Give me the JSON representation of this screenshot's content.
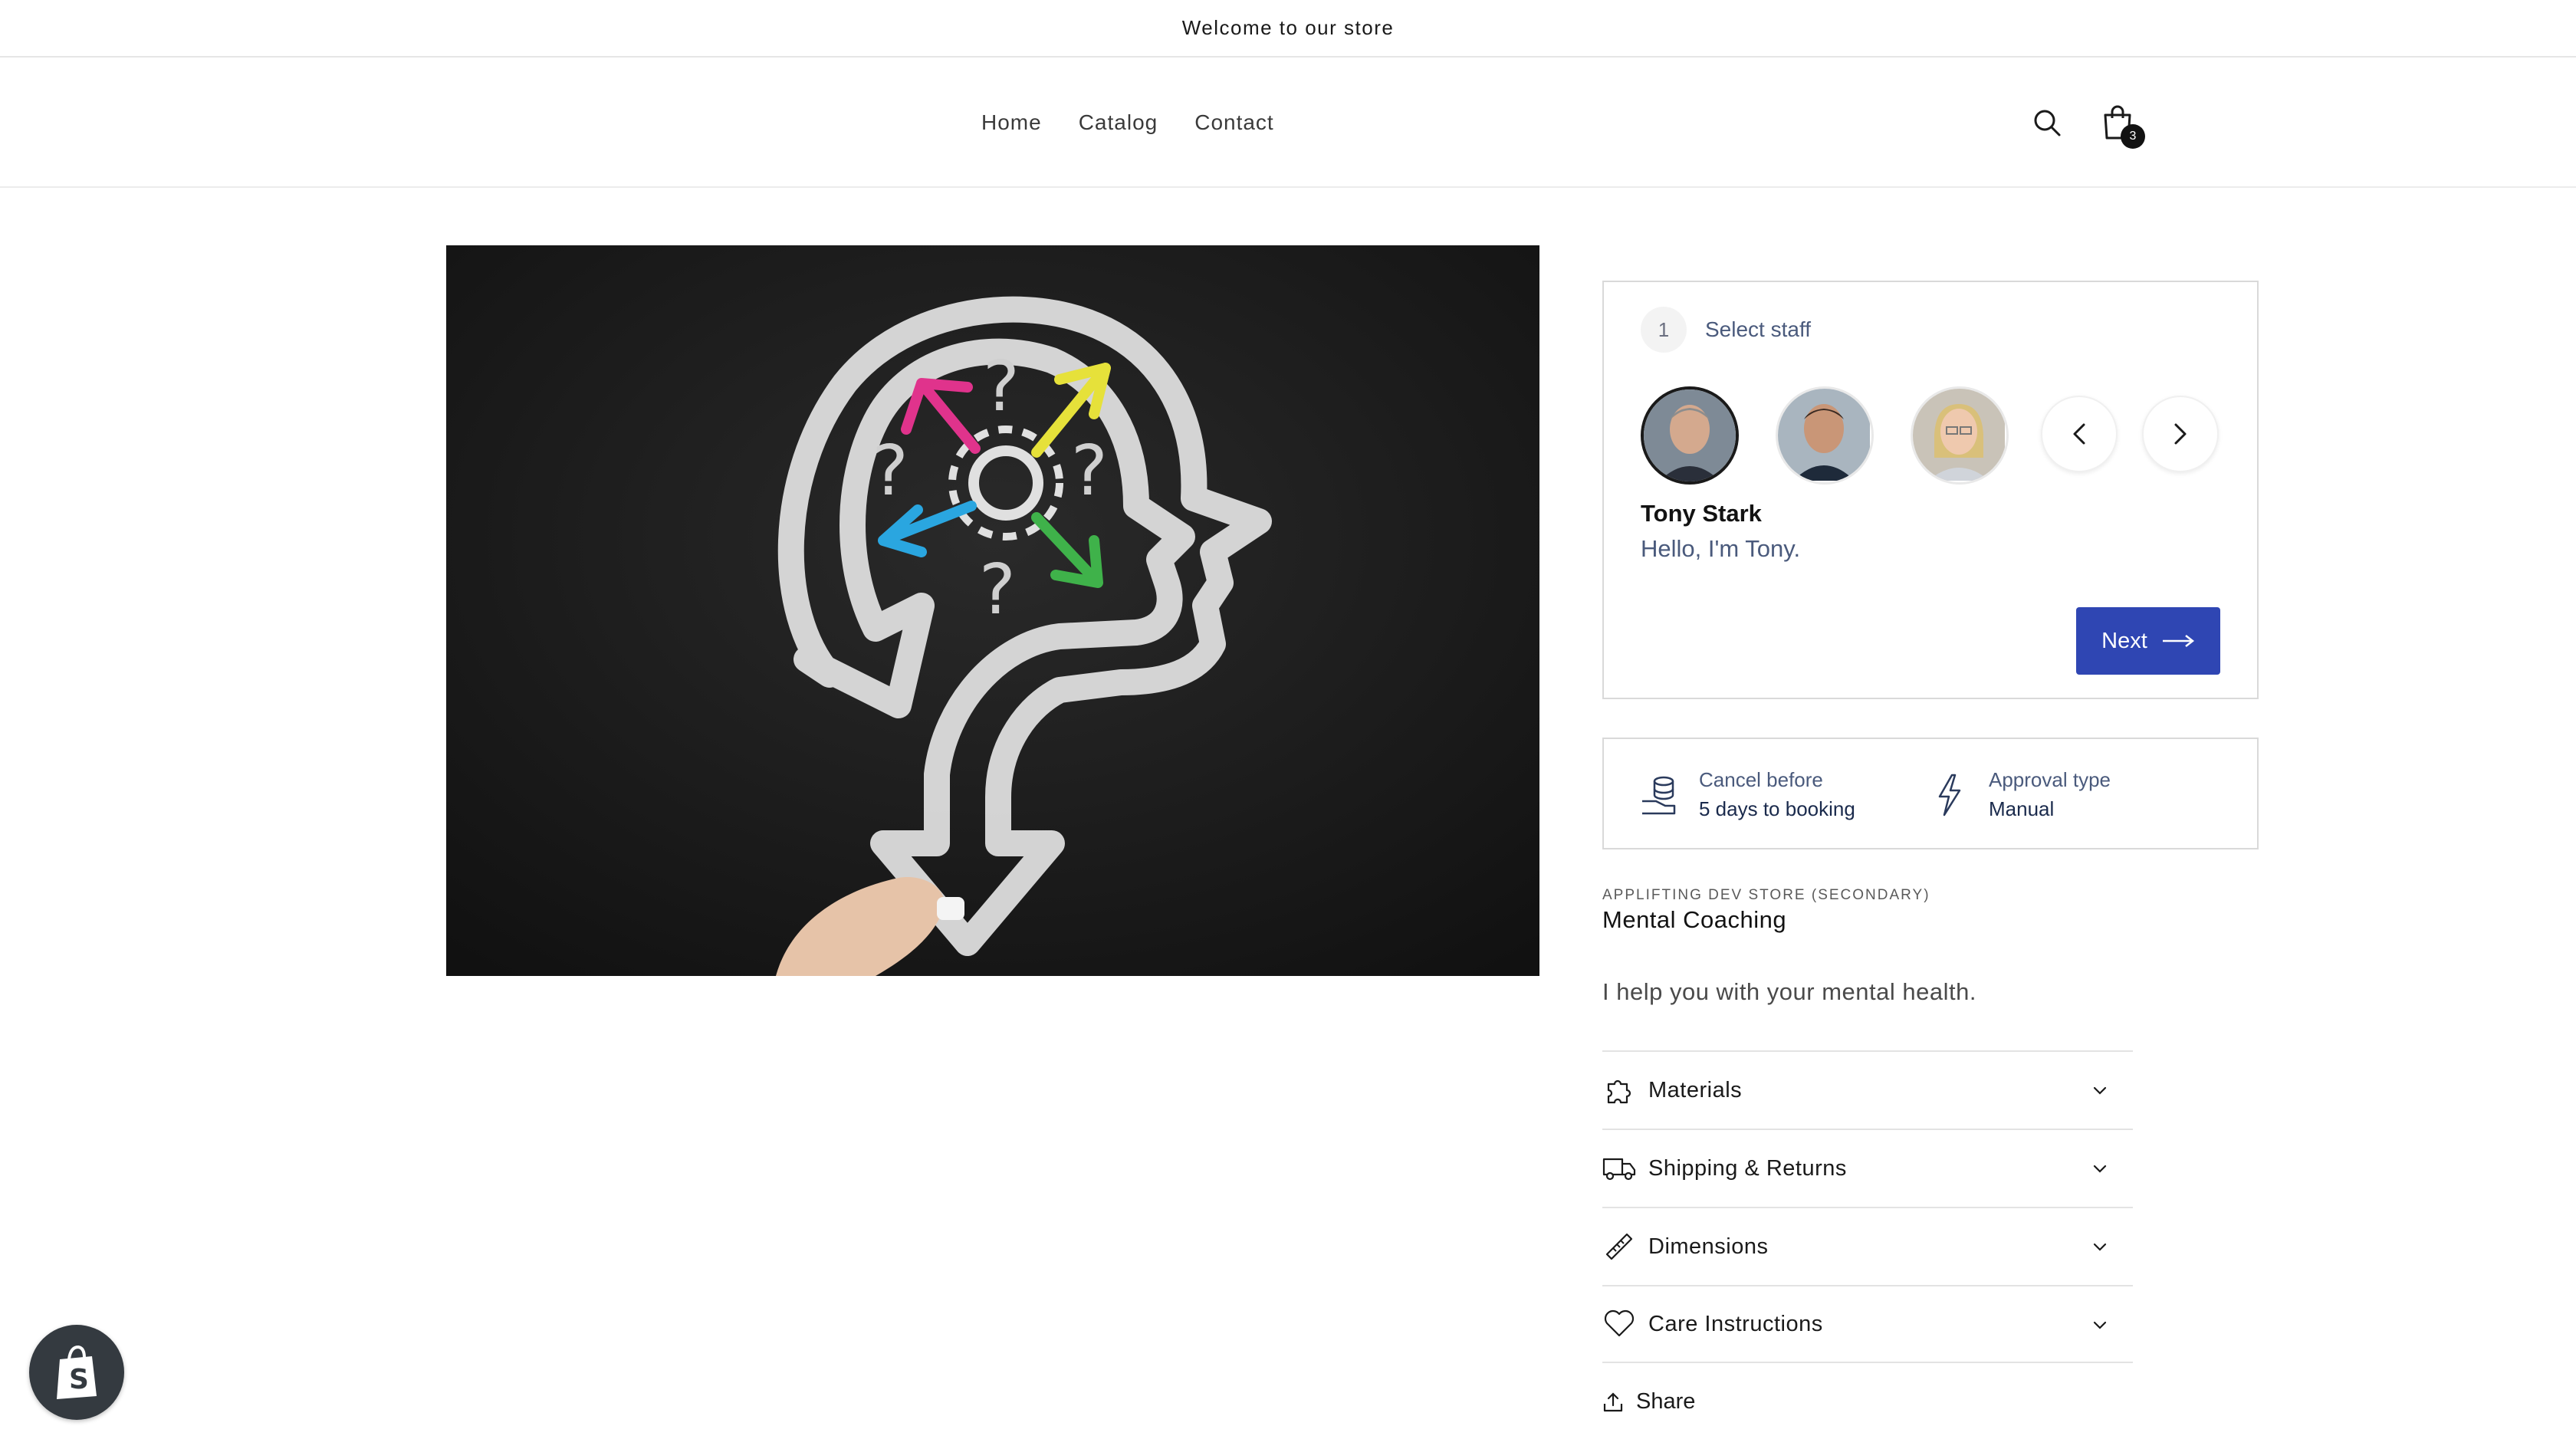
{
  "announcement": {
    "text": "Welcome to our store"
  },
  "header": {
    "nav": [
      {
        "label": "Home"
      },
      {
        "label": "Catalog"
      },
      {
        "label": "Contact"
      }
    ],
    "cart_count": "3"
  },
  "booking": {
    "step_number": "1",
    "step_label": "Select staff",
    "selected_staff": {
      "name": "Tony Stark",
      "bio": "Hello, I'm Tony."
    },
    "next_label": "Next"
  },
  "policy": {
    "cancel_label": "Cancel before",
    "cancel_value": "5 days to booking",
    "approval_label": "Approval type",
    "approval_value": "Manual"
  },
  "product": {
    "vendor": "APPLIFTING DEV STORE (SECONDARY)",
    "title": "Mental Coaching",
    "description": "I help you with your mental health."
  },
  "accordion": [
    {
      "label": "Materials"
    },
    {
      "label": "Shipping & Returns"
    },
    {
      "label": "Dimensions"
    },
    {
      "label": "Care Instructions"
    }
  ],
  "share_label": "Share",
  "colors": {
    "accent": "#2f46b3",
    "text_muted": "#4a5a7c"
  }
}
